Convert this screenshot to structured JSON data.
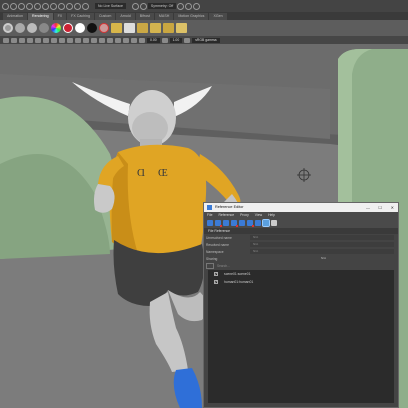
{
  "toolbar": {
    "select_mode": "No Live Surface",
    "symmetry": "Symmetry: Off"
  },
  "shelf_tabs": [
    "Animation",
    "Rendering",
    "FX",
    "FX Caching",
    "Custom",
    "Arnold",
    "Bifrost",
    "MASH",
    "Motion Graphics",
    "XGen"
  ],
  "viewport_toolbar": {
    "value1": "0.00",
    "value2": "1.00",
    "color_space": "sRGB gamma"
  },
  "reference_editor": {
    "title": "Reference Editor",
    "window_controls": [
      "—",
      "☐",
      "✕"
    ],
    "menu": [
      "File",
      "Reference",
      "Proxy",
      "View",
      "Help"
    ],
    "section": "File Reference",
    "fields": [
      {
        "label": "Unresolved name",
        "value": "N/A"
      },
      {
        "label": "Resolved name",
        "value": "N/A"
      },
      {
        "label": "Namespace",
        "value": "N/A"
      },
      {
        "label": "Sharing",
        "value": "N/A"
      }
    ],
    "list_items": [
      {
        "name": "scene01:scene01",
        "checked": true
      },
      {
        "name": "human01:human01",
        "checked": true
      }
    ],
    "filter_placeholder": "Search..."
  },
  "colors": {
    "shirt": "#e0a524",
    "floor": "#7c7c7c",
    "green_block": "#8fae8a",
    "wall": "#686868"
  }
}
